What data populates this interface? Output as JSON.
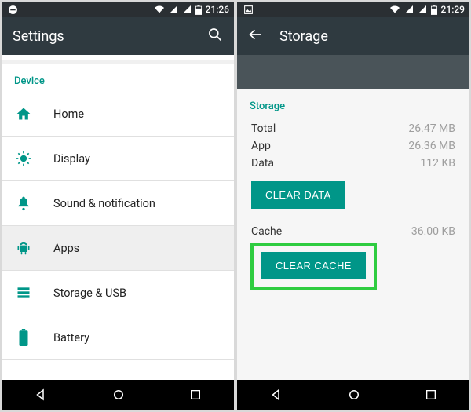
{
  "left": {
    "status": {
      "time": "21:26"
    },
    "appbar": {
      "title": "Settings"
    },
    "section": "Device",
    "items": [
      {
        "label": "Home"
      },
      {
        "label": "Display"
      },
      {
        "label": "Sound & notification"
      },
      {
        "label": "Apps"
      },
      {
        "label": "Storage & USB"
      },
      {
        "label": "Battery"
      }
    ]
  },
  "right": {
    "status": {
      "time": "21:29"
    },
    "appbar": {
      "title": "Storage"
    },
    "section": "Storage",
    "rows": {
      "total": {
        "k": "Total",
        "v": "26.47 MB"
      },
      "app": {
        "k": "App",
        "v": "26.36 MB"
      },
      "data": {
        "k": "Data",
        "v": "112 KB"
      }
    },
    "clearData": "CLEAR DATA",
    "cache": {
      "k": "Cache",
      "v": "36.00 KB"
    },
    "clearCache": "CLEAR CACHE"
  }
}
